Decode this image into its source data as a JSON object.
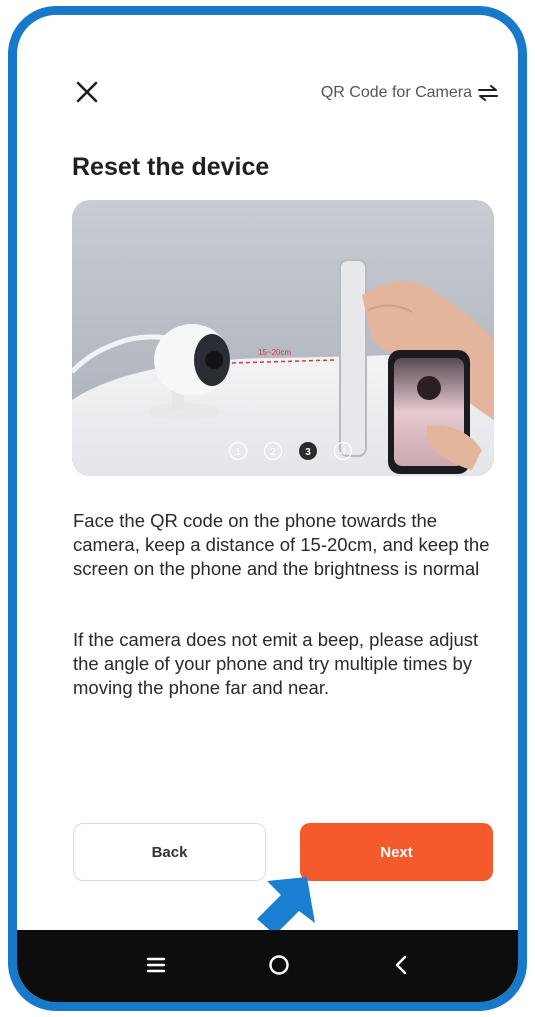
{
  "header": {
    "close_icon": "close-icon",
    "mode_switch_label": "QR Code for Camera",
    "mode_switch_icon": "swap-arrows-icon"
  },
  "page": {
    "title": "Reset the device"
  },
  "illustration": {
    "distance_label": "15~20cm",
    "steps": [
      "1",
      "2",
      "3",
      "4"
    ],
    "active_step": 3
  },
  "instructions": {
    "paragraph_1": "Face the QR code on the phone towards the camera, keep a distance of 15-20cm, and keep the screen on the phone and the brightness is normal",
    "paragraph_2": "If the camera does not emit a beep, please adjust the angle of your phone and try multiple times by moving the phone far and near."
  },
  "buttons": {
    "back_label": "Back",
    "next_label": "Next"
  },
  "nav_bar": {
    "icons": [
      "menu-icon",
      "home-icon",
      "back-icon"
    ]
  },
  "colors": {
    "frame": "#1878c9",
    "accent": "#f55a2c",
    "pointer": "#1a7fd0"
  }
}
